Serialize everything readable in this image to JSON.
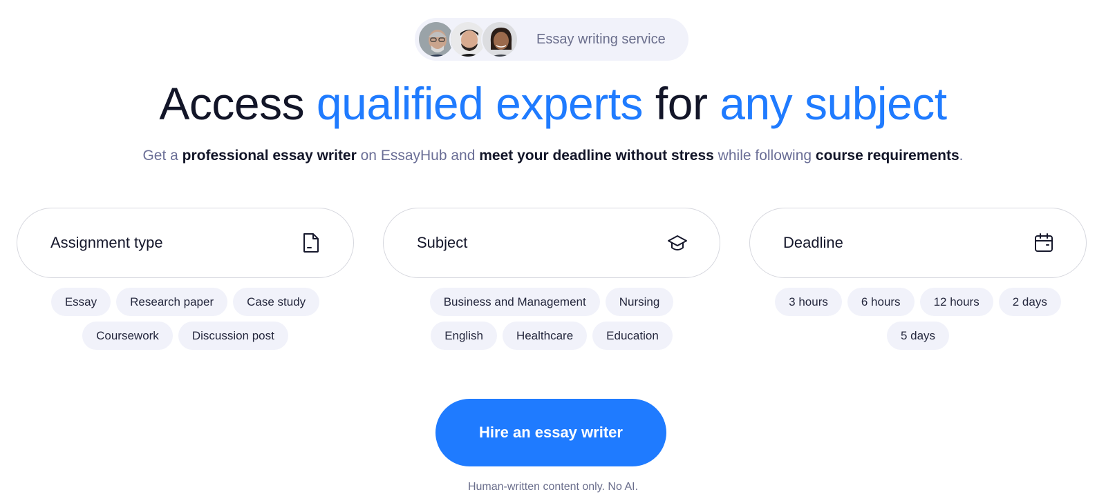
{
  "badge": {
    "text": "Essay writing service",
    "avatars": [
      "avatar-older-man",
      "avatar-young-man",
      "avatar-woman"
    ]
  },
  "headline": {
    "part1": "Access ",
    "part2": "qualified experts",
    "part3": " for ",
    "part4": "any subject",
    "accent_color": "#1f7bff"
  },
  "subline": {
    "s1": "Get a ",
    "b1": "professional essay writer",
    "s2": " on EssayHub and ",
    "b2": "meet your deadline without stress",
    "s3": " while following ",
    "b3": "course requirements",
    "s4": "."
  },
  "fields": [
    {
      "label": "Assignment type",
      "icon": "document-icon",
      "chips": [
        "Essay",
        "Research paper",
        "Case study",
        "Coursework",
        "Discussion post"
      ]
    },
    {
      "label": "Subject",
      "icon": "graduation-cap-icon",
      "chips": [
        "Business and Management",
        "Nursing",
        "English",
        "Healthcare",
        "Education"
      ]
    },
    {
      "label": "Deadline",
      "icon": "calendar-icon",
      "chips": [
        "3 hours",
        "6 hours",
        "12 hours",
        "2 days",
        "5 days"
      ]
    }
  ],
  "cta": {
    "label": "Hire an essay writer",
    "color": "#1f7bff"
  },
  "note": "Human-written content only. No AI."
}
